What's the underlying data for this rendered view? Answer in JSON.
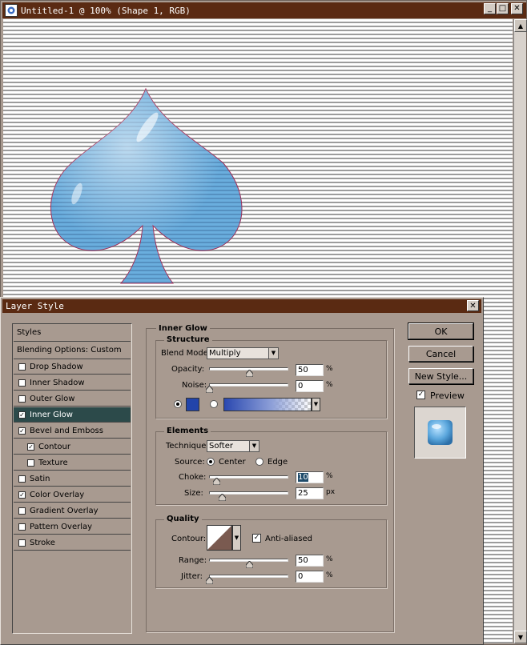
{
  "document": {
    "title": "Untitled-1 @ 100% (Shape 1, RGB)",
    "controls": {
      "minimize": "_",
      "restore": "□",
      "close": "✕"
    },
    "scroll_up": "▲",
    "scroll_down": "▼"
  },
  "dialog": {
    "title": "Layer Style",
    "close": "✕",
    "styles_header": "Styles",
    "blending_options": "Blending Options: Custom",
    "style_items": [
      {
        "label": "Drop Shadow",
        "checked": false,
        "sub": false,
        "selected": false
      },
      {
        "label": "Inner Shadow",
        "checked": false,
        "sub": false,
        "selected": false
      },
      {
        "label": "Outer Glow",
        "checked": false,
        "sub": false,
        "selected": false
      },
      {
        "label": "Inner Glow",
        "checked": true,
        "sub": false,
        "selected": true
      },
      {
        "label": "Bevel and Emboss",
        "checked": true,
        "sub": false,
        "selected": false
      },
      {
        "label": "Contour",
        "checked": true,
        "sub": true,
        "selected": false
      },
      {
        "label": "Texture",
        "checked": false,
        "sub": true,
        "selected": false
      },
      {
        "label": "Satin",
        "checked": false,
        "sub": false,
        "selected": false
      },
      {
        "label": "Color Overlay",
        "checked": true,
        "sub": false,
        "selected": false
      },
      {
        "label": "Gradient Overlay",
        "checked": false,
        "sub": false,
        "selected": false
      },
      {
        "label": "Pattern Overlay",
        "checked": false,
        "sub": false,
        "selected": false
      },
      {
        "label": "Stroke",
        "checked": false,
        "sub": false,
        "selected": false
      }
    ],
    "check_mark": "✓",
    "inner_glow": {
      "title": "Inner Glow",
      "structure": {
        "title": "Structure",
        "blend_mode_label": "Blend Mode:",
        "blend_mode_value": "Multiply",
        "opacity_label": "Opacity:",
        "opacity_value": "50",
        "noise_label": "Noise:",
        "noise_value": "0",
        "percent": "%",
        "glow_color": "#2244aa"
      },
      "elements": {
        "title": "Elements",
        "technique_label": "Technique:",
        "technique_value": "Softer",
        "source_label": "Source:",
        "source_center": "Center",
        "source_edge": "Edge",
        "choke_label": "Choke:",
        "choke_value": "10",
        "size_label": "Size:",
        "size_value": "25",
        "px": "px"
      },
      "quality": {
        "title": "Quality",
        "contour_label": "Contour:",
        "anti_aliased_label": "Anti-aliased",
        "range_label": "Range:",
        "range_value": "50",
        "jitter_label": "Jitter:",
        "jitter_value": "0"
      }
    },
    "buttons": {
      "ok": "OK",
      "cancel": "Cancel",
      "new_style": "New Style..."
    },
    "preview_label": "Preview",
    "colors": {
      "titlebar": "#5a2a12",
      "dialog_bg": "#a89a90",
      "selected_row": "#2c4a4a",
      "spade": "#5fa3d6"
    }
  }
}
